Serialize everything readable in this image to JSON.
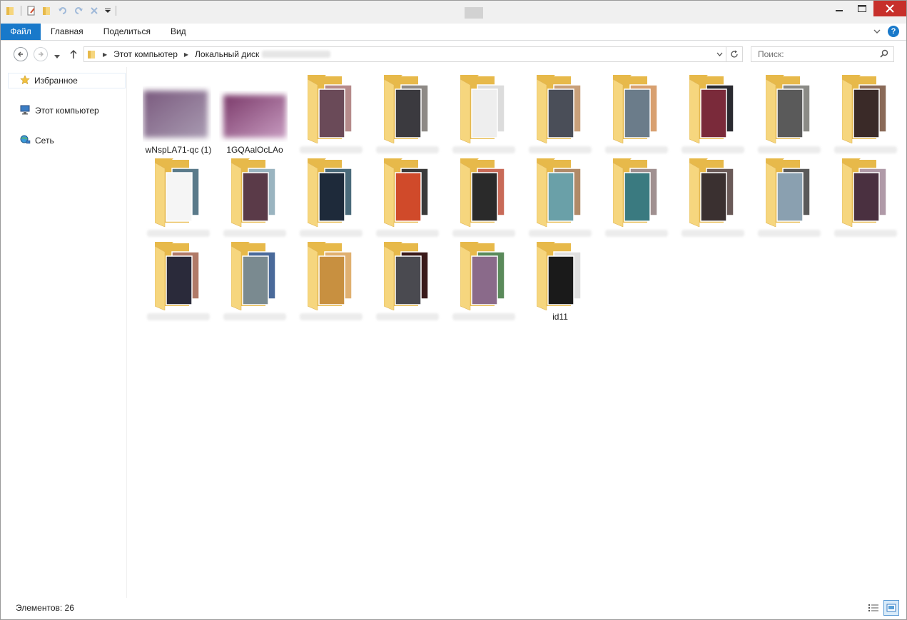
{
  "ribbon": {
    "tabs": [
      "Файл",
      "Главная",
      "Поделиться",
      "Вид"
    ],
    "help_label": "?"
  },
  "address": {
    "crumbs": [
      "Этот компьютер",
      "Локальный диск"
    ]
  },
  "search": {
    "placeholder": "Поиск:"
  },
  "sidebar": {
    "favorites": "Избранное",
    "computer": "Этот компьютер",
    "network": "Сеть"
  },
  "items": [
    {
      "name": "wNspLA71-qc (1)",
      "kind": "image",
      "colors": [
        "#7a5a7e",
        "#a99bb2"
      ]
    },
    {
      "name": "1GQAalOcLAo",
      "kind": "image",
      "colors": [
        "#7b3a6a",
        "#c79bc0"
      ]
    },
    {
      "name": "",
      "kind": "folder",
      "colors": [
        "#6a4a58",
        "#b58a8a"
      ]
    },
    {
      "name": "",
      "kind": "folder",
      "colors": [
        "#3b3a3f",
        "#8e8a86"
      ]
    },
    {
      "name": "",
      "kind": "folder",
      "colors": [
        "#eeeeee",
        "#dcdcdc"
      ]
    },
    {
      "name": "",
      "kind": "folder",
      "colors": [
        "#4a4e58",
        "#c8a07a"
      ]
    },
    {
      "name": "",
      "kind": "folder",
      "colors": [
        "#6b7c8a",
        "#d8a070"
      ]
    },
    {
      "name": "",
      "kind": "folder",
      "colors": [
        "#7a2a3a",
        "#2a2a30"
      ]
    },
    {
      "name": "",
      "kind": "folder",
      "colors": [
        "#5a5a5a",
        "#8b8b86"
      ]
    },
    {
      "name": "",
      "kind": "folder",
      "colors": [
        "#3a2a28",
        "#8a6a58"
      ]
    },
    {
      "name": "",
      "kind": "folder",
      "colors": [
        "#f5f5f5",
        "#5a7a8a"
      ]
    },
    {
      "name": "",
      "kind": "folder",
      "colors": [
        "#5a3a48",
        "#9ab4c0"
      ]
    },
    {
      "name": "",
      "kind": "folder",
      "colors": [
        "#1e2a3a",
        "#4a6a7a"
      ]
    },
    {
      "name": "",
      "kind": "folder",
      "colors": [
        "#d04a2a",
        "#3a3a3a"
      ]
    },
    {
      "name": "",
      "kind": "folder",
      "colors": [
        "#2a2a2a",
        "#c86a58"
      ]
    },
    {
      "name": "",
      "kind": "folder",
      "colors": [
        "#6aa0a8",
        "#b08a68"
      ]
    },
    {
      "name": "",
      "kind": "folder",
      "colors": [
        "#3a7a80",
        "#a09090"
      ]
    },
    {
      "name": "",
      "kind": "folder",
      "colors": [
        "#3a3030",
        "#6a5a58"
      ]
    },
    {
      "name": "",
      "kind": "folder",
      "colors": [
        "#8aa0b0",
        "#5a5a5a"
      ]
    },
    {
      "name": "",
      "kind": "folder",
      "colors": [
        "#4a3040",
        "#b09aa8"
      ]
    },
    {
      "name": "",
      "kind": "folder",
      "colors": [
        "#2a2a3a",
        "#b07a68"
      ]
    },
    {
      "name": "",
      "kind": "folder",
      "colors": [
        "#7a8a90",
        "#4a6a9a"
      ]
    },
    {
      "name": "",
      "kind": "folder",
      "colors": [
        "#c89040",
        "#e0b070"
      ]
    },
    {
      "name": "",
      "kind": "folder",
      "colors": [
        "#4a4a50",
        "#3a1a1a"
      ]
    },
    {
      "name": "",
      "kind": "folder",
      "colors": [
        "#8a6a8a",
        "#5a8a5a"
      ]
    },
    {
      "name": "id11",
      "kind": "folder",
      "colors": [
        "#1a1a1a",
        "#e0e0e0"
      ]
    }
  ],
  "status": {
    "count_text": "Элементов: 26"
  },
  "colors": {
    "accent": "#1979ca",
    "folder": "#f6d67e",
    "folder_dark": "#e7b94a",
    "close": "#c7302b"
  }
}
